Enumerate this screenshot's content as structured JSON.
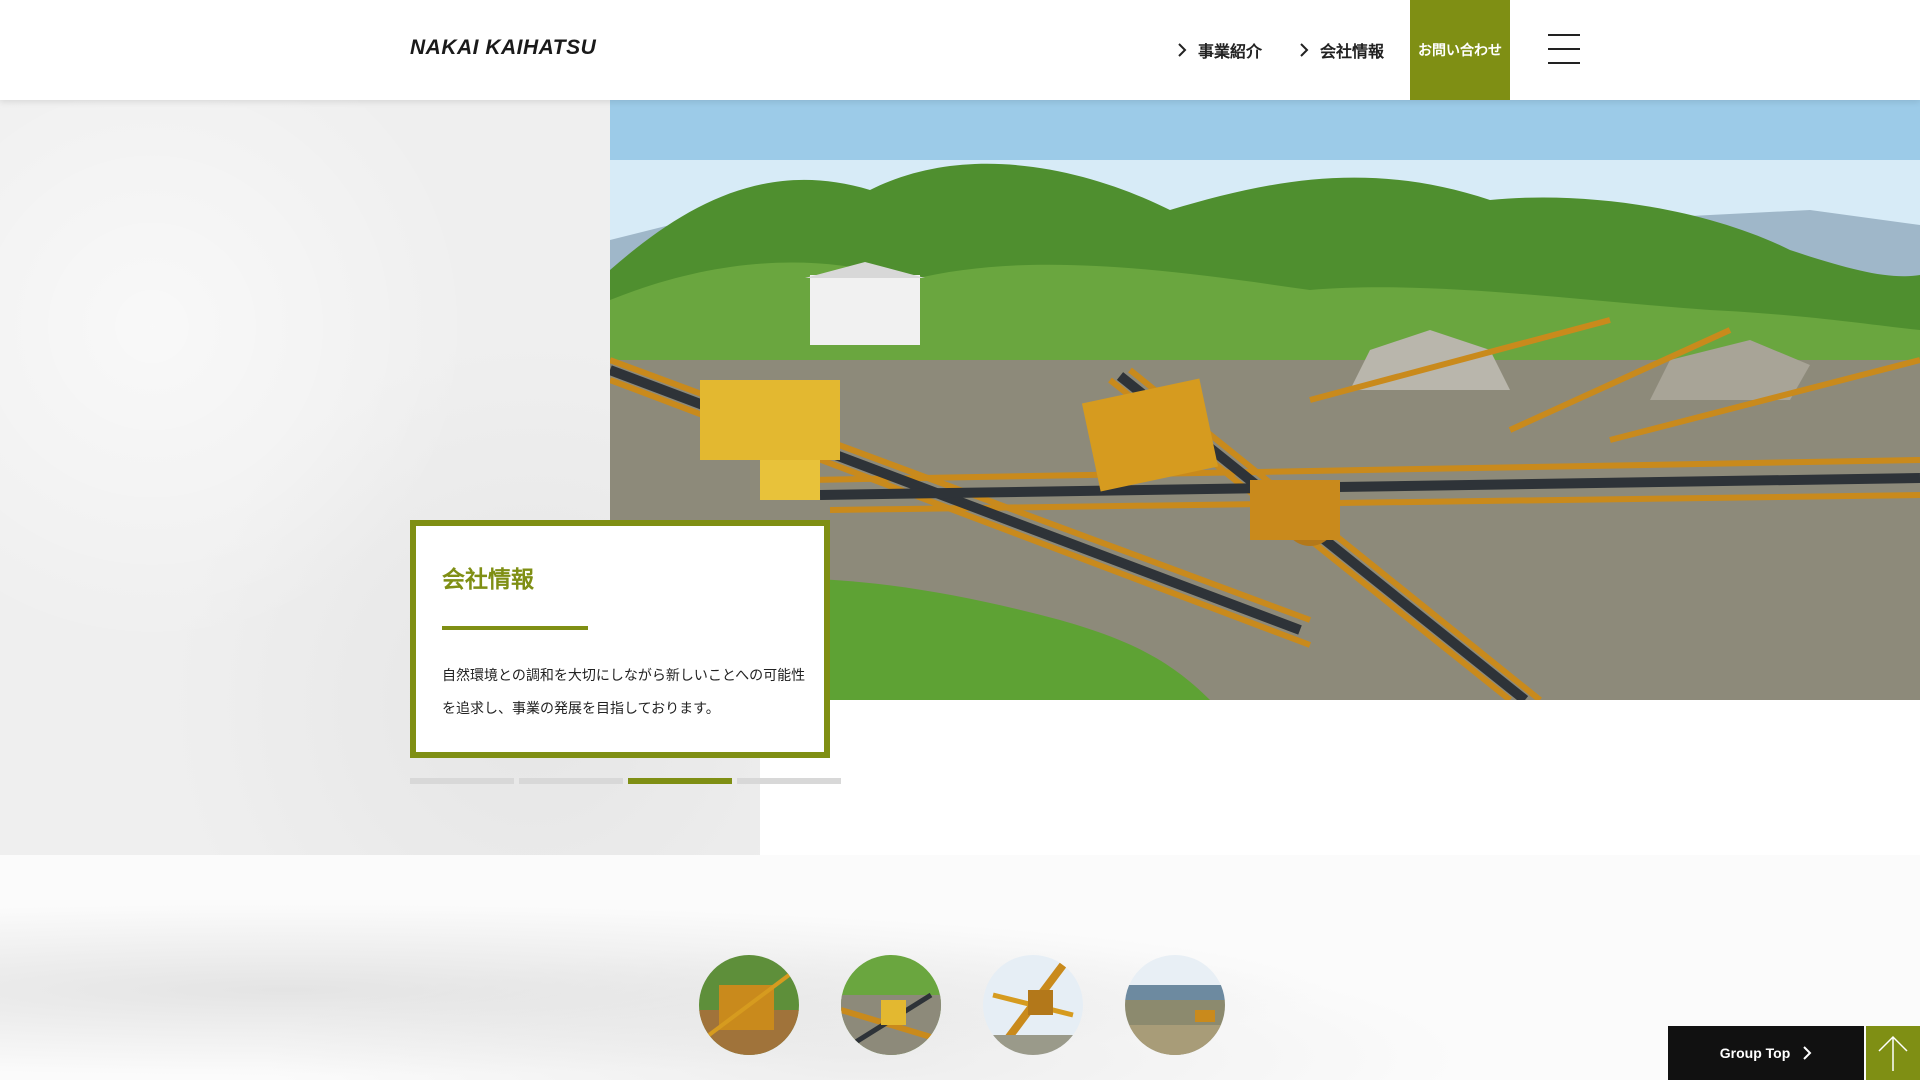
{
  "header": {
    "logo": "NAKAI KAIHATSU",
    "nav": [
      {
        "label": "事業紹介"
      },
      {
        "label": "会社情報"
      }
    ],
    "contact_label": "お問い合わせ",
    "menu_icon": "hamburger-menu-icon"
  },
  "hero": {
    "title": "会社情報",
    "description": "自然環境との調和を大切にしながら新しいことへの可能性を追求し、事業の発展を目指しております。",
    "slides_total": 4,
    "active_slide": 3,
    "photo": "aggregate-plant-conveyors"
  },
  "thumbnails": [
    {
      "image": "plant-structure-thumb"
    },
    {
      "image": "conveyor-aerial-thumb"
    },
    {
      "image": "crane-machinery-thumb"
    },
    {
      "image": "quarry-landscape-thumb"
    }
  ],
  "footer": {
    "group_top_label": "Group Top",
    "back_to_top_icon": "arrow-up-icon"
  },
  "colors": {
    "accent": "#7f8f14",
    "dark": "#111111"
  }
}
